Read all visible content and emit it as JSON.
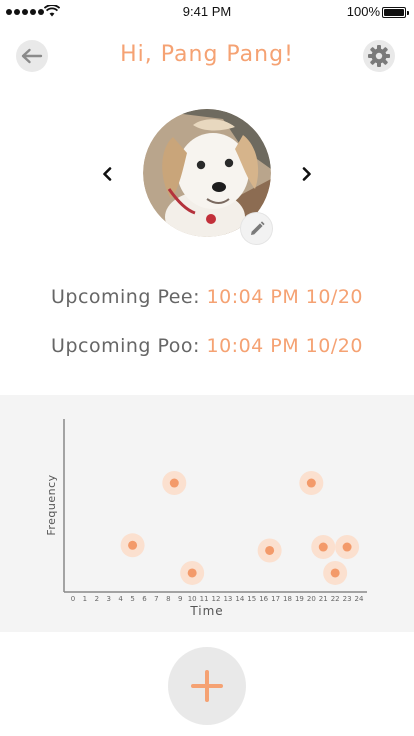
{
  "status_bar": {
    "time": "9:41 PM",
    "battery": "100%"
  },
  "header": {
    "greeting": "Hi, Pang Pang!"
  },
  "upcoming": {
    "pee_label": "Upcoming Pee:",
    "pee_value": "10:04 PM 10/20",
    "poo_label": "Upcoming Poo:",
    "poo_value": "10:04 PM 10/20"
  },
  "icons": {
    "back": "arrow-left-icon",
    "settings": "gear-icon",
    "edit": "pencil-icon",
    "prev": "chevron-left-icon",
    "next": "chevron-right-icon",
    "add": "plus-icon"
  },
  "colors": {
    "accent": "#f5a273",
    "dot_fill": "#f39a6a",
    "dot_halo": "#fbe0cf",
    "panel": "#f4f4f4"
  },
  "chart_data": {
    "type": "scatter",
    "xlabel": "Time",
    "ylabel": "Frequency",
    "x_ticks": [
      "0",
      "1",
      "2",
      "3",
      "4",
      "5",
      "6",
      "7",
      "8",
      "9",
      "10",
      "11",
      "12",
      "13",
      "14",
      "15",
      "16",
      "17",
      "18",
      "19",
      "20",
      "21",
      "22",
      "23",
      "24"
    ],
    "xlim": [
      0,
      24
    ],
    "ylim": [
      0,
      10
    ],
    "grid": false,
    "points": [
      {
        "x": 5,
        "y": 2.7
      },
      {
        "x": 8.5,
        "y": 6.3
      },
      {
        "x": 10,
        "y": 1.1
      },
      {
        "x": 16.5,
        "y": 2.4
      },
      {
        "x": 20,
        "y": 6.3
      },
      {
        "x": 21,
        "y": 2.6
      },
      {
        "x": 22,
        "y": 1.1
      },
      {
        "x": 23,
        "y": 2.6
      }
    ]
  }
}
